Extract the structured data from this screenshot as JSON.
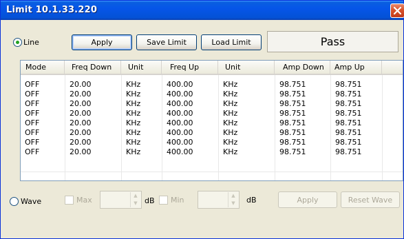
{
  "window": {
    "title": "Limit  10.1.33.220"
  },
  "controls": {
    "line_radio_label": "Line",
    "apply_label": "Apply",
    "save_limit_label": "Save Limit",
    "load_limit_label": "Load Limit",
    "status_text": "Pass"
  },
  "table": {
    "headers": [
      "Mode",
      "Freq Down",
      "Unit",
      "Freq Up",
      "Unit",
      "Amp Down",
      "Amp Up"
    ],
    "rows": [
      [
        "OFF",
        "20.00",
        "KHz",
        "400.00",
        "KHz",
        "98.751",
        "98.751"
      ],
      [
        "OFF",
        "20.00",
        "KHz",
        "400.00",
        "KHz",
        "98.751",
        "98.751"
      ],
      [
        "OFF",
        "20.00",
        "KHz",
        "400.00",
        "KHz",
        "98.751",
        "98.751"
      ],
      [
        "OFF",
        "20.00",
        "KHz",
        "400.00",
        "KHz",
        "98.751",
        "98.751"
      ],
      [
        "OFF",
        "20.00",
        "KHz",
        "400.00",
        "KHz",
        "98.751",
        "98.751"
      ],
      [
        "OFF",
        "20.00",
        "KHz",
        "400.00",
        "KHz",
        "98.751",
        "98.751"
      ],
      [
        "OFF",
        "20.00",
        "KHz",
        "400.00",
        "KHz",
        "98.751",
        "98.751"
      ],
      [
        "OFF",
        "20.00",
        "KHz",
        "400.00",
        "KHz",
        "98.751",
        "98.751"
      ]
    ]
  },
  "wave": {
    "radio_label": "Wave",
    "max_label": "Max",
    "max_unit": "dB",
    "min_label": "Min",
    "min_unit": "dB",
    "apply_label": "Apply",
    "reset_label": "Reset Wave"
  },
  "icons": {
    "close": "close-icon",
    "spin_up": "chevron-up-icon",
    "spin_down": "chevron-down-icon"
  },
  "colors": {
    "titlebar": "#0655e8",
    "close_button": "#d8522a",
    "radio_dot": "#21a121"
  }
}
